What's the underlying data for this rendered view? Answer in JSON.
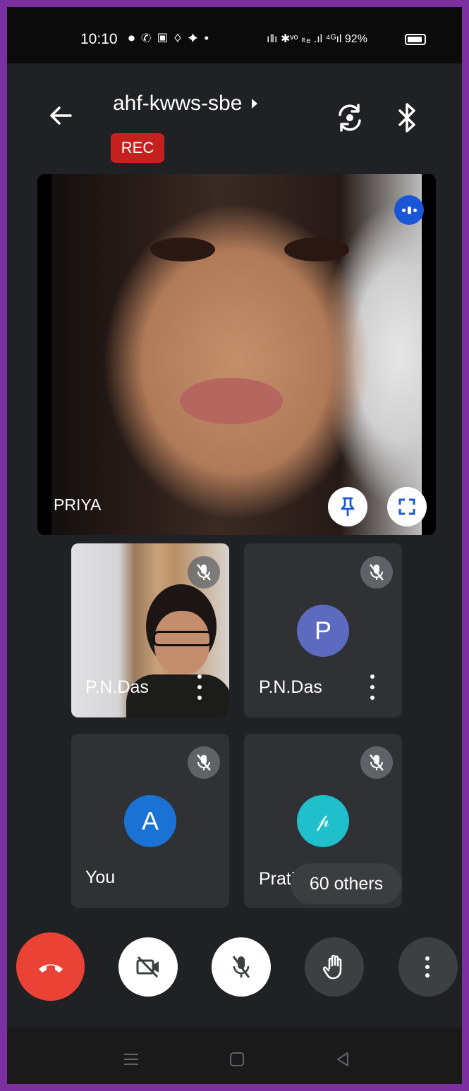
{
  "status_bar": {
    "time": "10:10",
    "left_icons": "⏺ ✆ ▣ ♢ ✦ •",
    "right_text": "ıǁı ✱ᵛᵒ ₗₜₑ .ıl ⁴ᴳıl 92%",
    "battery": "92%"
  },
  "header": {
    "meeting_code": "ahf-kwws-sbe",
    "rec_label": "REC"
  },
  "main_tile": {
    "name": "PRIYA"
  },
  "tiles": [
    {
      "name": "P.N.Das",
      "type": "video",
      "muted": true
    },
    {
      "name": "P.N.Das",
      "type": "avatar",
      "avatar_letter": "P",
      "avatar_color": "#5c6bc0",
      "muted": true
    },
    {
      "name": "You",
      "type": "avatar",
      "avatar_letter": "A",
      "avatar_color": "#1a73d4",
      "muted": true
    },
    {
      "name": "Prati",
      "type": "avatar",
      "avatar_letter": "𝓅",
      "avatar_color": "#1fbfcc",
      "muted": true
    }
  ],
  "others_label": "60 others",
  "controls": {
    "end_call_color": "#ea4335"
  },
  "icons": {
    "back": "arrow-left-icon",
    "switch_camera": "switch-camera-icon",
    "bluetooth": "bluetooth-icon",
    "pin": "pin-icon",
    "fullscreen": "fullscreen-icon",
    "mic_off": "mic-off-icon",
    "camera_off": "camera-off-icon",
    "raise_hand": "hand-icon",
    "more": "more-vert-icon",
    "end_call": "phone-hangup-icon"
  }
}
